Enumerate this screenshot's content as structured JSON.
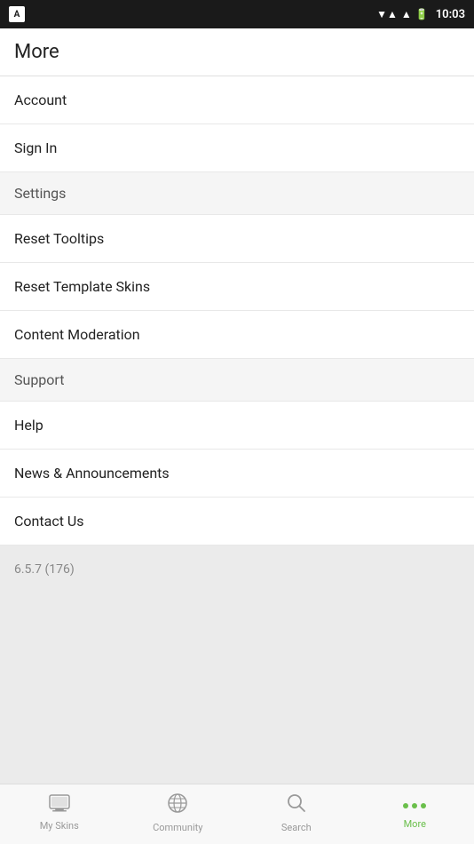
{
  "statusBar": {
    "time": "10:03",
    "appIconLabel": "A"
  },
  "header": {
    "title": "More"
  },
  "menuItems": [
    {
      "id": "account",
      "label": "Account",
      "type": "item"
    },
    {
      "id": "sign-in",
      "label": "Sign In",
      "type": "item"
    },
    {
      "id": "settings",
      "label": "Settings",
      "type": "section"
    },
    {
      "id": "reset-tooltips",
      "label": "Reset Tooltips",
      "type": "item"
    },
    {
      "id": "reset-template-skins",
      "label": "Reset Template Skins",
      "type": "item"
    },
    {
      "id": "content-moderation",
      "label": "Content Moderation",
      "type": "item"
    },
    {
      "id": "support",
      "label": "Support",
      "type": "section"
    },
    {
      "id": "help",
      "label": "Help",
      "type": "item"
    },
    {
      "id": "news-announcements",
      "label": "News & Announcements",
      "type": "item"
    },
    {
      "id": "contact-us",
      "label": "Contact Us",
      "type": "item"
    }
  ],
  "version": {
    "text": "6.5.7 (176)"
  },
  "bottomNav": [
    {
      "id": "my-skins",
      "label": "My Skins",
      "icon": "🖥",
      "active": false
    },
    {
      "id": "community",
      "label": "Community",
      "icon": "🌐",
      "active": false
    },
    {
      "id": "search",
      "label": "Search",
      "icon": "🔍",
      "active": false
    },
    {
      "id": "more",
      "label": "More",
      "icon": "···",
      "active": true
    }
  ]
}
